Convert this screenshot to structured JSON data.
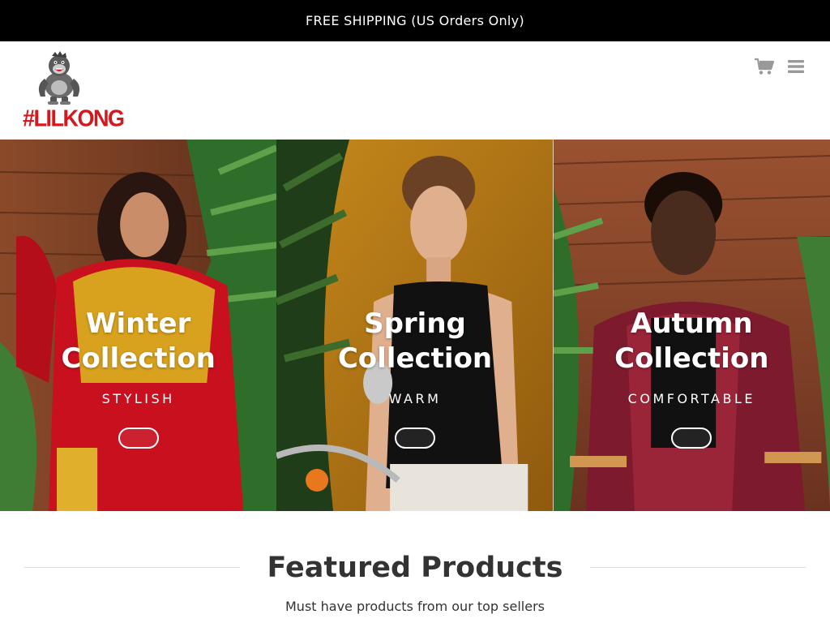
{
  "announcement": {
    "text": "FREE SHIPPING (US Orders Only)"
  },
  "header": {
    "logo": {
      "text": "#LILKONG",
      "icon": "gorilla-mascot-icon"
    },
    "actions": [
      {
        "icon": "shopping-cart-icon"
      },
      {
        "icon": "hamburger-menu-icon"
      }
    ]
  },
  "hero": {
    "panels": [
      {
        "title_line1": "Winter",
        "title_line2": "Collection",
        "subtitle": "STYLISH"
      },
      {
        "title_line1": "Spring",
        "title_line2": "Collection",
        "subtitle": "WARM"
      },
      {
        "title_line1": "Autumn",
        "title_line2": "Collection",
        "subtitle": "COMFORTABLE"
      }
    ]
  },
  "featured": {
    "title": "Featured Products",
    "subtitle": "Must have products from our top sellers"
  },
  "colors": {
    "topbar_bg": "#000000",
    "brand_red": "#d5181d",
    "header_icon": "#999999",
    "heading_text": "#333333"
  }
}
